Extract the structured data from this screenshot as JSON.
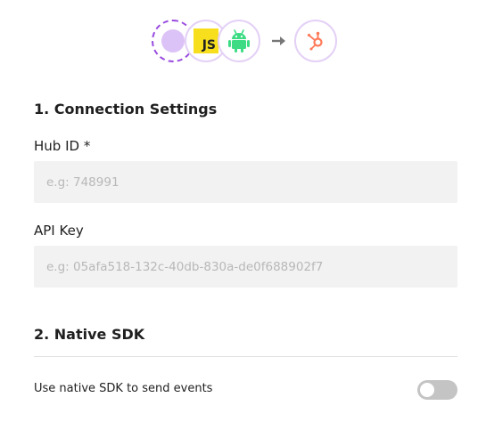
{
  "integration_flow": {
    "source_icon": "source-placeholder-dot",
    "sdk_icons": [
      "javascript-icon",
      "android-icon"
    ],
    "js_badge_text": "JS",
    "arrow_icon": "arrow-right-icon",
    "destination_icon": "hubspot-icon",
    "colors": {
      "accent_purple": "#9a4de0",
      "circle_border": "#e4d1f6",
      "js_yellow": "#f7df1e",
      "android_green": "#3ddc84",
      "hubspot_orange": "#ff7a59"
    }
  },
  "connection_settings": {
    "title": "1. Connection Settings",
    "hub_id": {
      "label": "Hub ID *",
      "value": "",
      "placeholder": "e.g: 748991"
    },
    "api_key": {
      "label": "API Key",
      "value": "",
      "placeholder": "e.g: 05afa518-132c-40db-830a-de0f688902f7"
    }
  },
  "native_sdk": {
    "title": "2. Native SDK",
    "toggle_label": "Use native SDK to send events",
    "toggle_on": false,
    "toggle_off_color": "#c4c4c4"
  }
}
